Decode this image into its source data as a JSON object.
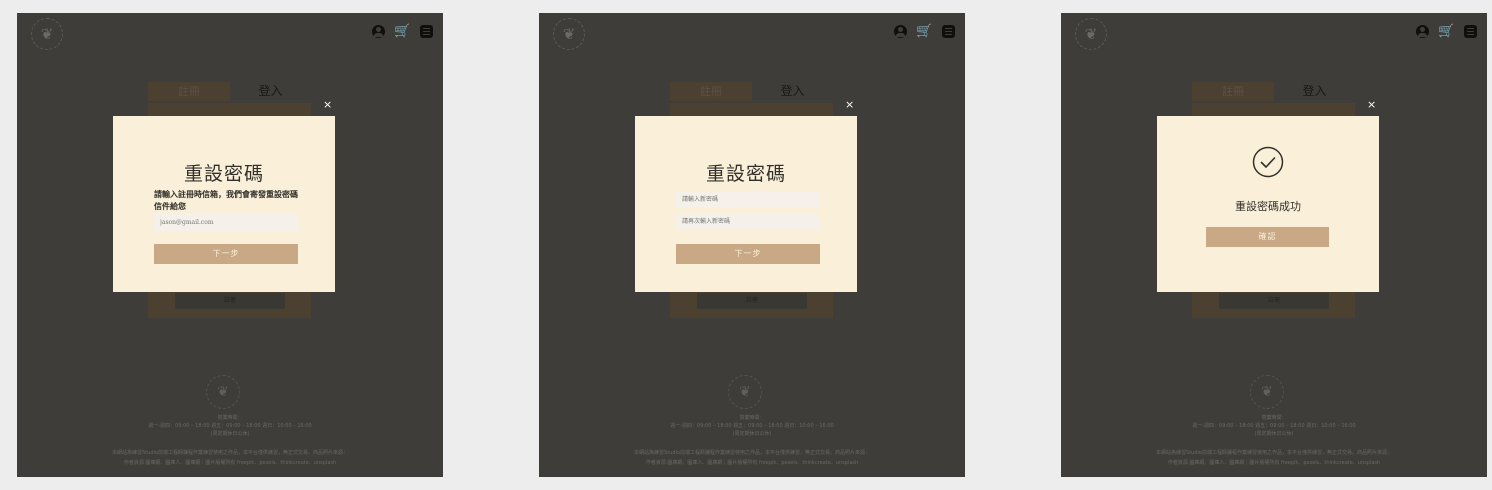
{
  "common": {
    "logo_glyph": "❦",
    "bg_tab_register": "註冊",
    "bg_tab_login": "登入",
    "bg_register_button": "註冊",
    "close_glyph": "×",
    "cart_glyph": "🛒",
    "footer": {
      "logo_glyph": "❦",
      "hours_title": "營業時間：",
      "hours": "週一-週四：09:00 – 18:00  週五：09:00 – 18:00  週日：10:00 – 16:00",
      "closed": "(周定期休日公休)",
      "disclaimer": "本網站為練習Studio前端工程師課程作業練習使用之作品，本平台僅供練習，無正式交易。商品照片來源：",
      "credits": "作者資源 圖庫網、圖庫人、圖庫網｜圖片版權所有 freepik、pexels、thinkcreate、unsplash"
    }
  },
  "screen1": {
    "title": "重設密碼",
    "description": "請輸入註冊時信箱，我們會寄發重設密碼信件給您",
    "email_placeholder": "jason@gmail.com",
    "next_button": "下一步"
  },
  "screen2": {
    "title": "重設密碼",
    "new_password_placeholder": "請輸入新密碼",
    "confirm_password_placeholder": "請再次輸入新密碼",
    "next_button": "下一步"
  },
  "screen3": {
    "success_message": "重設密碼成功",
    "confirm_button": "確認"
  }
}
